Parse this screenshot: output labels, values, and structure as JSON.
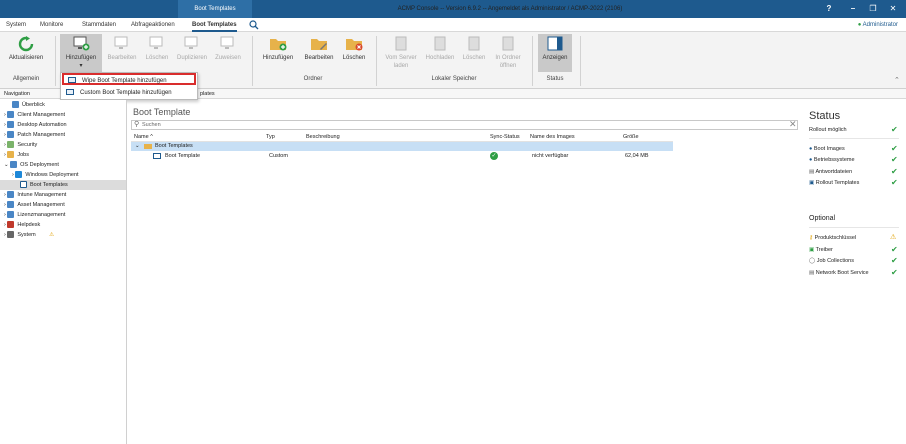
{
  "titlebar": {
    "context_tab": "Boot Templates",
    "title": "ACMP Console -- Version 6.9.2 -- Angemeldet als Administrator / ACMP-2022 (2106)",
    "help": "?",
    "minimize": "–",
    "restore": "❐",
    "close": "✕"
  },
  "menu": {
    "items": [
      "System",
      "Monitore",
      "Stammdaten",
      "Abfrageaktionen",
      "Boot Templates"
    ],
    "user": "Administrator"
  },
  "ribbon": {
    "allgemein": {
      "refresh": "Aktualisieren",
      "label": "Allgemein"
    },
    "templates": {
      "add": "Hinzufügen",
      "edit": "Bearbeiten",
      "delete": "Löschen",
      "duplicate": "Duplizieren",
      "assign": "Zuweisen"
    },
    "ordner": {
      "add": "Hinzufügen",
      "edit": "Bearbeiten",
      "delete": "Löschen",
      "label": "Ordner"
    },
    "lokal": {
      "load": "Vom Server laden",
      "upload": "Hochladen",
      "delete": "Löschen",
      "open": "In Ordner öffnen",
      "label": "Lokaler Speicher"
    },
    "status": {
      "show": "Anzeigen",
      "label": "Status"
    }
  },
  "dropdown": {
    "items": [
      "Wipe Boot Template hinzufügen",
      "Custom Boot Template hinzufügen"
    ]
  },
  "navrow": {
    "label": "Navigation",
    "crumb": "plates"
  },
  "tree": {
    "items": [
      "Überblick",
      "Client Management",
      "Desktop Automation",
      "Patch Management",
      "Security",
      "Jobs",
      "OS Deployment",
      "Windows Deployment",
      "Boot Templates",
      "Intune Management",
      "Asset Management",
      "Lizenzmanagement",
      "Helpdesk",
      "System"
    ]
  },
  "main": {
    "title": "Boot Template",
    "search_placeholder": "Suchen",
    "columns": [
      "Name",
      "Typ",
      "Beschreibung",
      "Sync-Status",
      "Name des Images",
      "Größe"
    ],
    "group": "Boot Templates",
    "rows": [
      {
        "name": "Boot Template",
        "type": "Custom",
        "desc": "",
        "image": "nicht verfügbar",
        "size": "62,04 MB"
      }
    ]
  },
  "status_panel": {
    "title": "Status",
    "rollout": "Rollout möglich",
    "items": [
      "Boot Images",
      "Betriebssysteme",
      "Antwortdateien",
      "Rollout Templates"
    ],
    "optional_title": "Optional",
    "optional_items": [
      "Produktschlüssel",
      "Treiber",
      "Job Collections",
      "Network Boot Service"
    ]
  },
  "colors": {
    "accent": "#1e5a8e",
    "ok": "#2e9e44",
    "warn": "#e0a000",
    "highlight": "#d92d2d"
  }
}
